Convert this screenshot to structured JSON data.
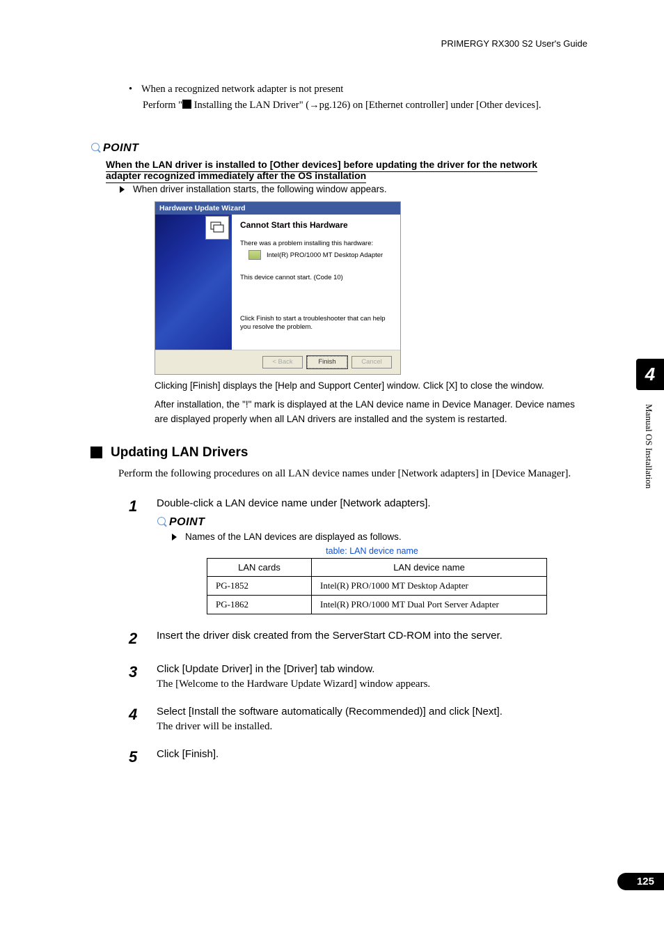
{
  "header": {
    "guide_title": "PRIMERGY RX300 S2 User's Guide"
  },
  "intro_bullet": {
    "text": "When a recognized network adapter is not present",
    "sub_pre": "Perform \"",
    "sub_mid": " Installing the LAN Driver\" (",
    "sub_arrow": "→",
    "sub_post": "pg.126) on [Ethernet controller] under [Other devices]."
  },
  "point": {
    "label": "POINT",
    "bold_line1": "When the LAN driver is installed to [Other devices] before updating the driver for the network",
    "bold_line2": "adapter recognized immediately after the OS installation",
    "list_item": "When driver installation starts, the following window appears."
  },
  "wizard": {
    "title": "Hardware Update Wizard",
    "heading": "Cannot Start this Hardware",
    "text1": "There was a problem installing this hardware:",
    "hw_name": "Intel(R) PRO/1000 MT Desktop Adapter",
    "text2": "This device cannot start. (Code 10)",
    "text3": "Click Finish to start a troubleshooter that can help you resolve the problem.",
    "btn_back": "< Back",
    "btn_finish": "Finish",
    "btn_cancel": "Cancel"
  },
  "after_wizard": {
    "line1": "Clicking [Finish] displays the [Help and Support Center] window. Click [X] to close the window.",
    "line2": "After installation, the \"!\" mark is displayed at the LAN device name in Device Manager. Device names are displayed properly when all LAN drivers are installed and the system is restarted."
  },
  "section": {
    "title": "Updating LAN Drivers",
    "intro": "Perform the following procedures on all LAN device names under [Network adapters] in [Device Manager]."
  },
  "steps": [
    {
      "num": "1",
      "main": "Double-click a LAN device name under [Network adapters].",
      "point_label": "POINT",
      "point_item": "Names of the LAN devices are displayed as follows.",
      "table_caption": "table: LAN device name",
      "table": {
        "header": [
          "LAN cards",
          "LAN device name"
        ],
        "rows": [
          [
            "PG-1852",
            "Intel(R) PRO/1000 MT Desktop Adapter"
          ],
          [
            "PG-1862",
            "Intel(R) PRO/1000 MT Dual Port Server Adapter"
          ]
        ]
      }
    },
    {
      "num": "2",
      "main": "Insert the driver disk created from the ServerStart CD-ROM into the server."
    },
    {
      "num": "3",
      "main": "Click [Update Driver] in the [Driver] tab window.",
      "sub": "The [Welcome to the Hardware Update Wizard] window appears."
    },
    {
      "num": "4",
      "main": "Select [Install the software automatically (Recommended)] and click [Next].",
      "sub": "The driver will be installed."
    },
    {
      "num": "5",
      "main": "Click [Finish]."
    }
  ],
  "side": {
    "chapter": "4",
    "text": "Manual OS Installation"
  },
  "page_number": "125"
}
